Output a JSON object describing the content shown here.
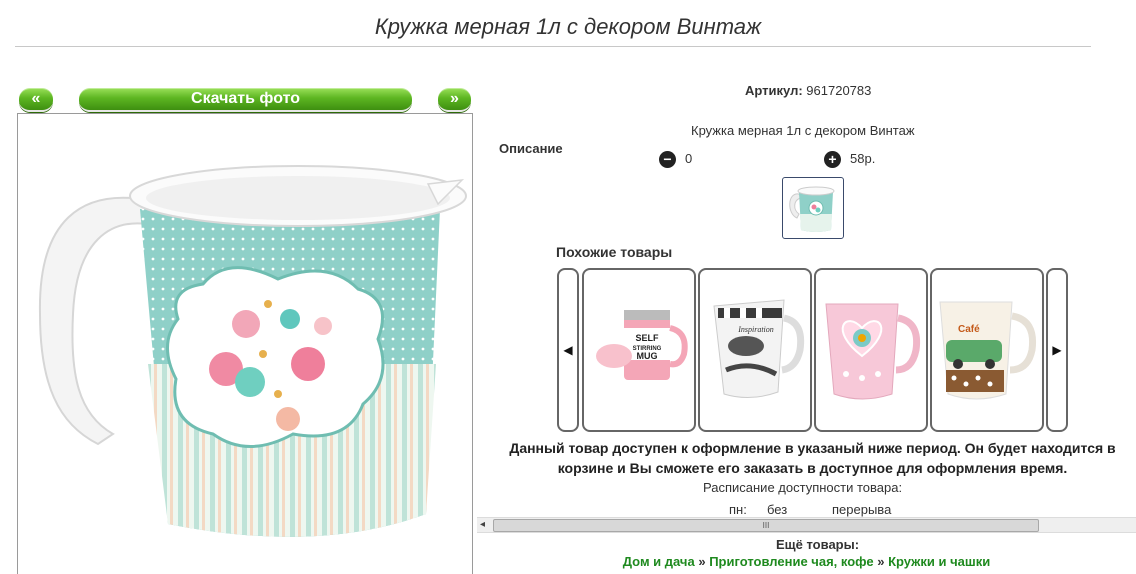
{
  "page": {
    "title": "Кружка мерная 1л с декором Винтаж"
  },
  "photo_nav": {
    "prev_label": "«",
    "download_label": "Скачать фото",
    "next_label": "»"
  },
  "product": {
    "sku_label": "Артикул:",
    "sku_value": "961720783",
    "description_label": "Описание",
    "description_text": "Кружка мерная 1л с декором Винтаж",
    "quantity": "0",
    "price": "58р."
  },
  "similar": {
    "heading": "Похожие товары",
    "prev_label": "◀",
    "next_label": "▶",
    "items": [
      {
        "name": "self-stirring-mug",
        "print": "SELF STIRRING MUG"
      },
      {
        "name": "black-white-mug",
        "print": "Inspiration"
      },
      {
        "name": "pink-heart-mug",
        "print": ""
      },
      {
        "name": "car-mug",
        "print": "Café"
      }
    ]
  },
  "availability": {
    "notice": "Данный товар доступен к оформление в указаный ниже период. Он будет находится в корзине и Вы сможете его заказать в доступное для оформления время.",
    "schedule_label": "Расписание доступности товара:",
    "day": "пн:",
    "from": "без",
    "to": "перерыва"
  },
  "scrollbar": {
    "left_arrow": "◂",
    "grip": "III"
  },
  "more": {
    "heading": "Ещё товары:",
    "crumbs": [
      "Дом и дача",
      "Приготовление чая, кофе",
      "Кружки и чашки"
    ],
    "separator": "»"
  }
}
